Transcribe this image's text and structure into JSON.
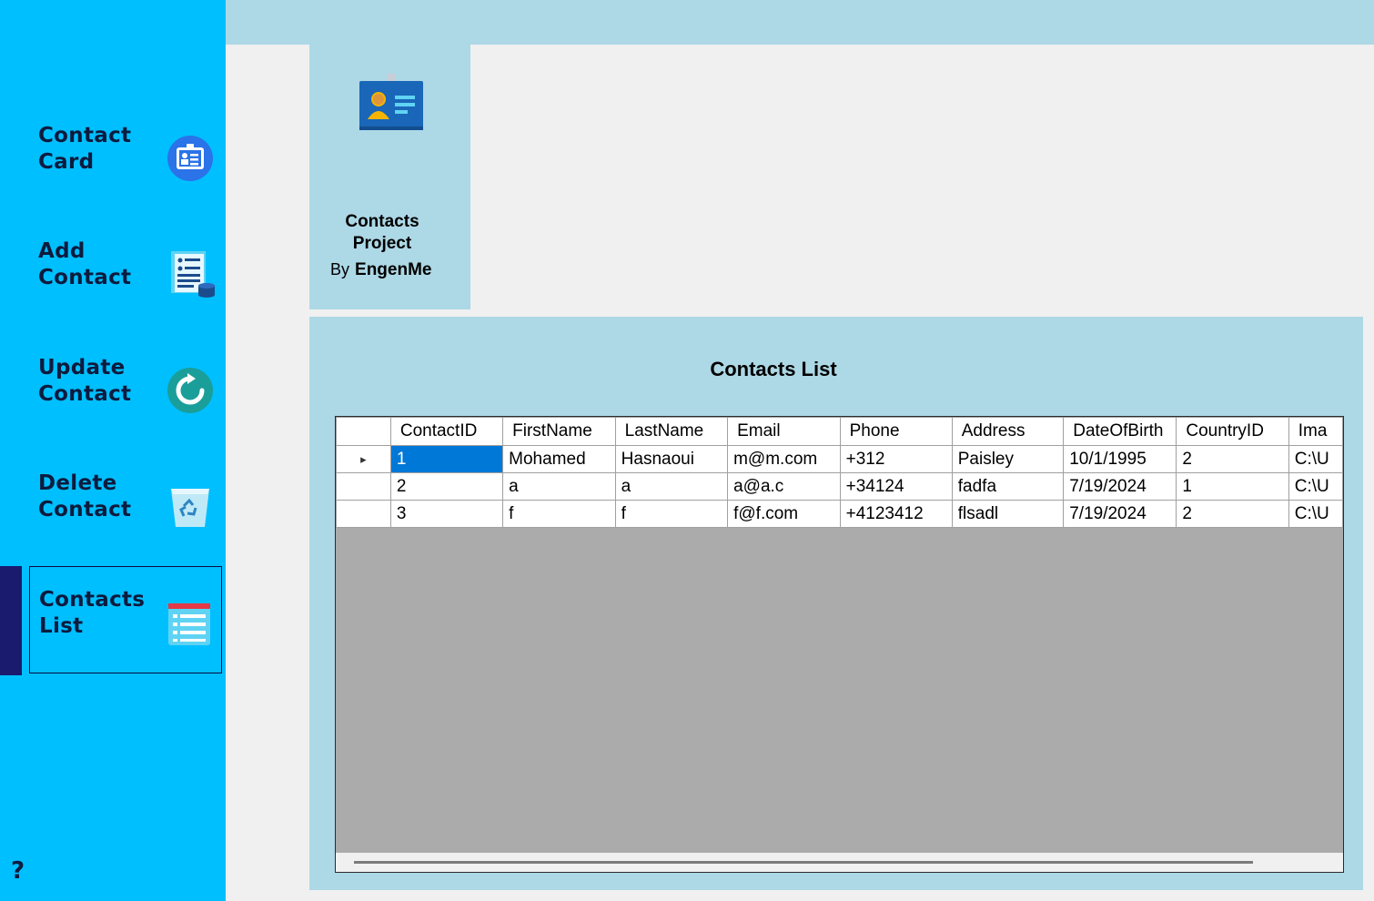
{
  "sidebar": {
    "items": [
      {
        "label_line1": "Contact",
        "label_line2": "Card",
        "icon": "contact-card-icon"
      },
      {
        "label_line1": "Add",
        "label_line2": "Contact",
        "icon": "add-contact-icon"
      },
      {
        "label_line1": "Update",
        "label_line2": "Contact",
        "icon": "refresh-icon"
      },
      {
        "label_line1": "Delete",
        "label_line2": "Contact",
        "icon": "recycle-bin-icon"
      },
      {
        "label_line1": "Contacts",
        "label_line2": "List",
        "icon": "list-icon",
        "active": true
      }
    ],
    "help_label": "?"
  },
  "info_card": {
    "title_line1": "Contacts",
    "title_line2": "Project",
    "by_label": "By",
    "author": "EngenMe",
    "icon": "id-badge-icon"
  },
  "contacts_list": {
    "title": "Contacts List",
    "columns": [
      "ContactID",
      "FirstName",
      "LastName",
      "Email",
      "Phone",
      "Address",
      "DateOfBirth",
      "CountryID",
      "Ima"
    ],
    "rows": [
      [
        "1",
        "Mohamed",
        "Hasnaoui",
        "m@m.com",
        "+312",
        "Paisley",
        "10/1/1995",
        "2",
        "C:\\U"
      ],
      [
        "2",
        "a",
        "a",
        "a@a.c",
        "+34124",
        "fadfa",
        "7/19/2024",
        "1",
        "C:\\U"
      ],
      [
        "3",
        "f",
        "f",
        "f@f.com",
        "+4123412",
        "flsadl",
        "7/19/2024",
        "2",
        "C:\\U"
      ]
    ],
    "current_row_indicator": "▸"
  },
  "colors": {
    "sidebar": "#00bfff",
    "panel": "#add8e6",
    "selection": "#0078d7",
    "active_bar": "#1a1a6e"
  }
}
